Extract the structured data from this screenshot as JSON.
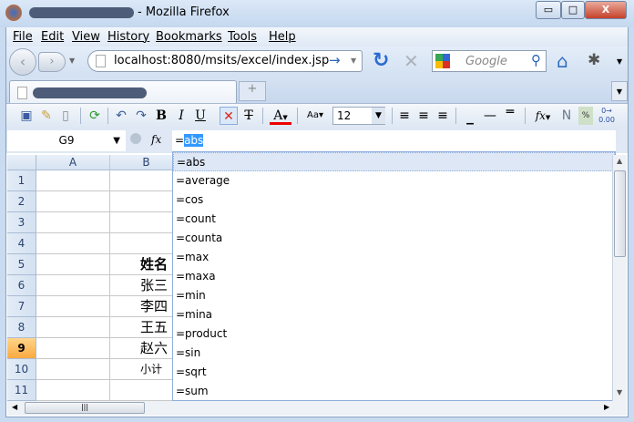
{
  "window": {
    "title": "- Mozilla Firefox",
    "minimize": "▭",
    "maximize": "□",
    "close": "X"
  },
  "menu": [
    "File",
    "Edit",
    "View",
    "History",
    "Bookmarks",
    "Tools",
    "Help"
  ],
  "nav": {
    "url": "localhost:8080/msits/excel/index.jsp",
    "search_placeholder": "Google",
    "go": "→",
    "reload": "↻",
    "stop": "✕"
  },
  "tabs": {
    "new_tab": "+"
  },
  "toolbar": {
    "bold": "B",
    "italic": "I",
    "underline": "U",
    "font_color": "A",
    "font_size": "12",
    "function": "fx"
  },
  "formula_bar": {
    "name_box": "G9",
    "fx": "fx",
    "value_prefix": "=",
    "value_selected": "abs"
  },
  "grid": {
    "columns": [
      "A",
      "B"
    ],
    "rows": [
      "1",
      "2",
      "3",
      "4",
      "5",
      "6",
      "7",
      "8",
      "9",
      "10",
      "11"
    ],
    "active_row": "9",
    "cells": {
      "B5": "姓名",
      "B6": "张三",
      "B7": "李四",
      "B8": "王五",
      "B9": "赵六",
      "B10": "小计"
    }
  },
  "autocomplete": [
    "=abs",
    "=average",
    "=cos",
    "=count",
    "=counta",
    "=max",
    "=maxa",
    "=min",
    "=mina",
    "=product",
    "=sin",
    "=sqrt",
    "=sum"
  ]
}
